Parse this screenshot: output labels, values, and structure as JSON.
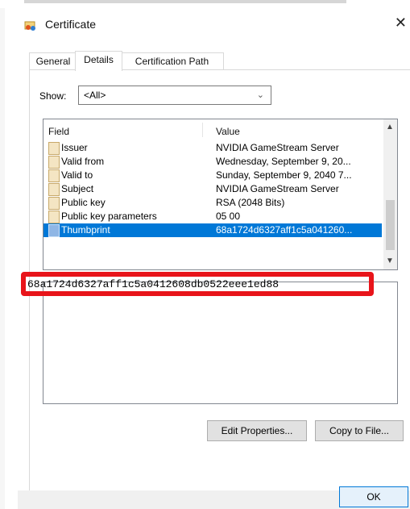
{
  "window": {
    "title": "Certificate",
    "close_glyph": "✕",
    "icon": "certificate-icon"
  },
  "tabs": [
    {
      "label": "General",
      "active": false
    },
    {
      "label": "Details",
      "active": true
    },
    {
      "label": "Certification Path",
      "active": false
    }
  ],
  "show": {
    "label": "Show:",
    "selected": "<All>"
  },
  "list": {
    "headers": {
      "field": "Field",
      "value": "Value"
    },
    "rows": [
      {
        "field": "Issuer",
        "value": "NVIDIA GameStream Server"
      },
      {
        "field": "Valid from",
        "value": "Wednesday, September 9, 20..."
      },
      {
        "field": "Valid to",
        "value": "Sunday, September 9, 2040 7..."
      },
      {
        "field": "Subject",
        "value": "NVIDIA GameStream Server"
      },
      {
        "field": "Public key",
        "value": "RSA (2048 Bits)"
      },
      {
        "field": "Public key parameters",
        "value": "05 00"
      },
      {
        "field": "Thumbprint",
        "value": "68a1724d6327aff1c5a041260..."
      }
    ],
    "selected_index": 6
  },
  "detail": {
    "value": "68a1724d6327aff1c5a0412608db0522eee1ed88"
  },
  "buttons": {
    "edit_properties": "Edit Properties...",
    "copy_to_file": "Copy to File...",
    "ok": "OK"
  },
  "colors": {
    "selection": "#0078d7",
    "highlight_border": "#e8141a"
  }
}
